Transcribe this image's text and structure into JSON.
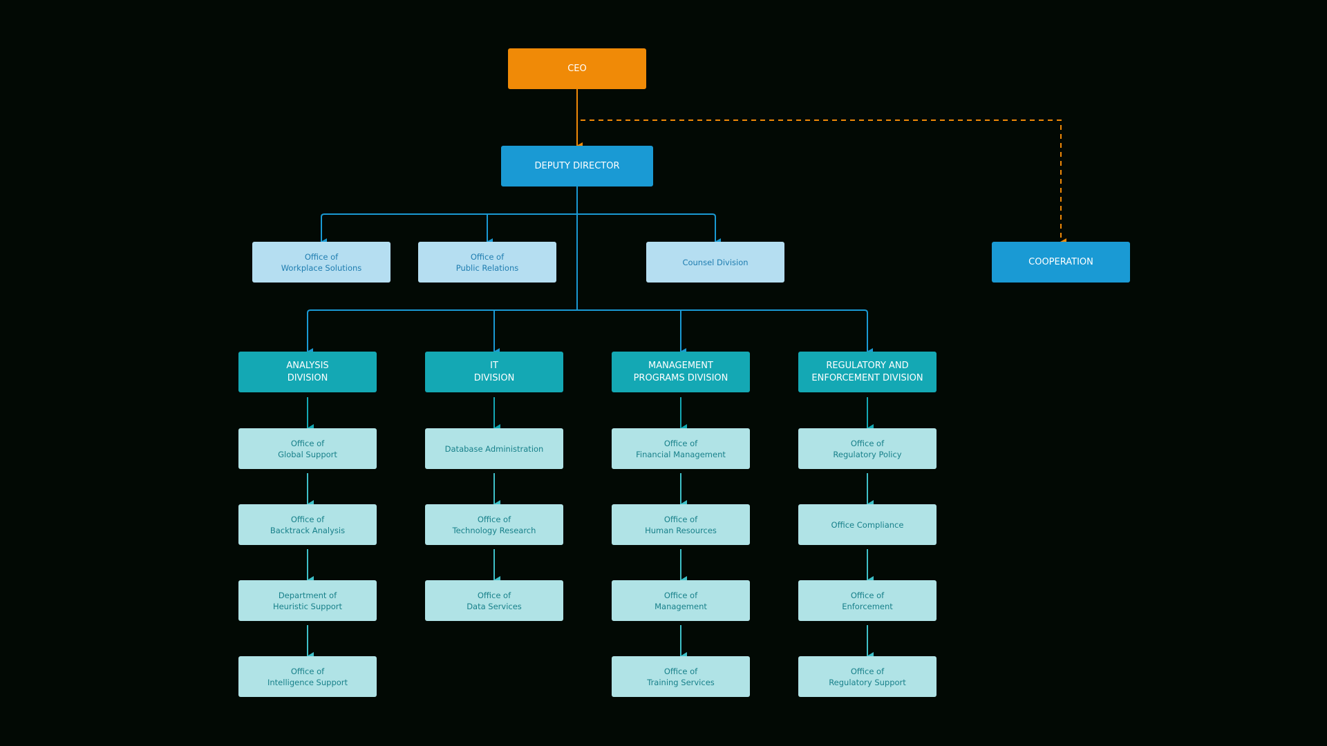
{
  "colors": {
    "ceo": "#f08a07",
    "deputy": "#1a9ad4",
    "division": "#14a8b4",
    "office_light_blue": "#b5def1",
    "office_light_teal": "#b0e3e6",
    "background": "#020904"
  },
  "nodes": {
    "ceo": "CEO",
    "deputy": "DEPUTY DIRECTOR",
    "cooperation": "COOPERATION",
    "workplace": "Office of\nWorkplace Solutions",
    "public_relations": "Office of\nPublic Relations",
    "counsel": "Counsel Division",
    "analysis": "ANALYSIS\nDIVISION",
    "it": "IT\nDIVISION",
    "management": "MANAGEMENT\nPROGRAMS DIVISION",
    "regulatory": "REGULATORY AND\nENFORCEMENT DIVISION",
    "global_support": "Office of\nGlobal Support",
    "backtrack": "Office of\nBacktrack Analysis",
    "heuristic": "Department of\nHeuristic Support",
    "intelligence": "Office of\nIntelligence Support",
    "database": "Database Administration",
    "tech_research": "Office of\nTechnology Research",
    "data_services": "Office of\nData Services",
    "financial": "Office of\nFinancial Management",
    "human_resources": "Office of\nHuman Resources",
    "office_management": "Office of\nManagement",
    "training": "Office of\nTraining Services",
    "reg_policy": "Office of\nRegulatory Policy",
    "compliance": "Office Compliance",
    "enforcement": "Office of\nEnforcement",
    "reg_support": "Office of\nRegulatory Support"
  }
}
